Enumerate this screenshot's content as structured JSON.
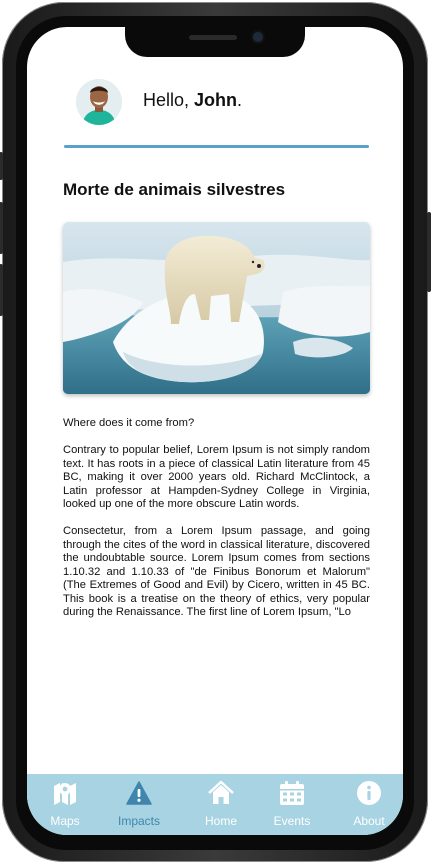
{
  "user": {
    "greeting_prefix": "Hello, ",
    "name": "John",
    "greeting_suffix": "."
  },
  "article": {
    "title": "Morte de animais silvestres",
    "image_alt": "Polar bear on a melting ice floe",
    "paragraphs": [
      "Where does it come from?",
      "Contrary to popular belief, Lorem Ipsum is not simply random text. It has roots in a piece of classical Latin literature from 45 BC, making it over 2000 years old. Richard McClintock, a Latin professor at Hampden-Sydney College in Virginia, looked up one of the more obscure Latin words.",
      "Consectetur, from a Lorem Ipsum passage, and going through the cites of the word in classical literature, discovered the undoubtable source. Lorem Ipsum comes from sections 1.10.32 and 1.10.33 of \"de Finibus Bonorum et Malorum\" (The Extremes of Good and Evil) by Cicero, written in 45 BC. This book is a treatise on the theory of ethics, very popular during the Renaissance. The first line of Lorem Ipsum, \"Lo"
    ]
  },
  "tabbar": {
    "tabs": [
      {
        "label": "Maps",
        "icon": "map-icon",
        "active": false
      },
      {
        "label": "Impacts",
        "icon": "warning-icon",
        "active": true
      },
      {
        "label": "Home",
        "icon": "home-icon",
        "active": false
      },
      {
        "label": "Events",
        "icon": "calendar-icon",
        "active": false
      },
      {
        "label": "About",
        "icon": "info-icon",
        "active": false
      }
    ]
  },
  "colors": {
    "accent": "#5aa0c8",
    "tabbar_bg": "#a8d3e3",
    "tab_active": "#3e86ad",
    "tab_inactive": "#ffffff"
  }
}
